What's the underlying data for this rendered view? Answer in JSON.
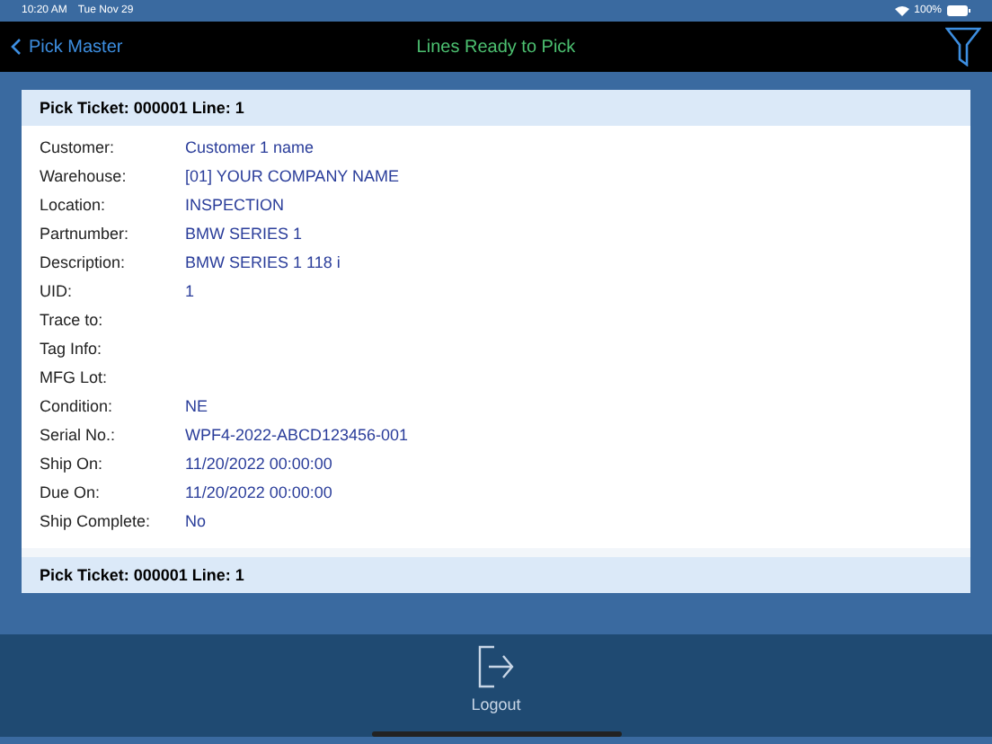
{
  "status_bar": {
    "time": "10:20 AM",
    "date": "Tue Nov 29",
    "battery": "100%"
  },
  "nav_bar": {
    "back": "Pick Master",
    "title": "Lines Ready to Pick"
  },
  "tickets": [
    {
      "title": "Pick Ticket: 000001 Line: 1",
      "fields": [
        {
          "label": "Customer:",
          "value": "Customer 1 name"
        },
        {
          "label": "Warehouse:",
          "value": "[01] YOUR COMPANY NAME"
        },
        {
          "label": "Location:",
          "value": "INSPECTION"
        },
        {
          "label": "Partnumber:",
          "value": "BMW SERIES 1"
        },
        {
          "label": "Description:",
          "value": "BMW SERIES 1 118 i"
        },
        {
          "label": "UID:",
          "value": "1"
        },
        {
          "label": "Trace to:"
        },
        {
          "label": "Tag Info:"
        },
        {
          "label": "MFG Lot:"
        },
        {
          "label": "Condition:",
          "value": "NE"
        },
        {
          "label": "Serial No.:",
          "value": "WPF4-2022-ABCD123456-001"
        },
        {
          "label": "Ship On:",
          "value": "11/20/2022 00:00:00"
        },
        {
          "label": "Due On:",
          "value": "11/20/2022 00:00:00"
        },
        {
          "label": "Ship Complete:",
          "value": "No"
        }
      ]
    },
    {
      "title": "Pick Ticket: 000001 Line: 1"
    }
  ],
  "tab_bar": {
    "label": "Logout"
  }
}
